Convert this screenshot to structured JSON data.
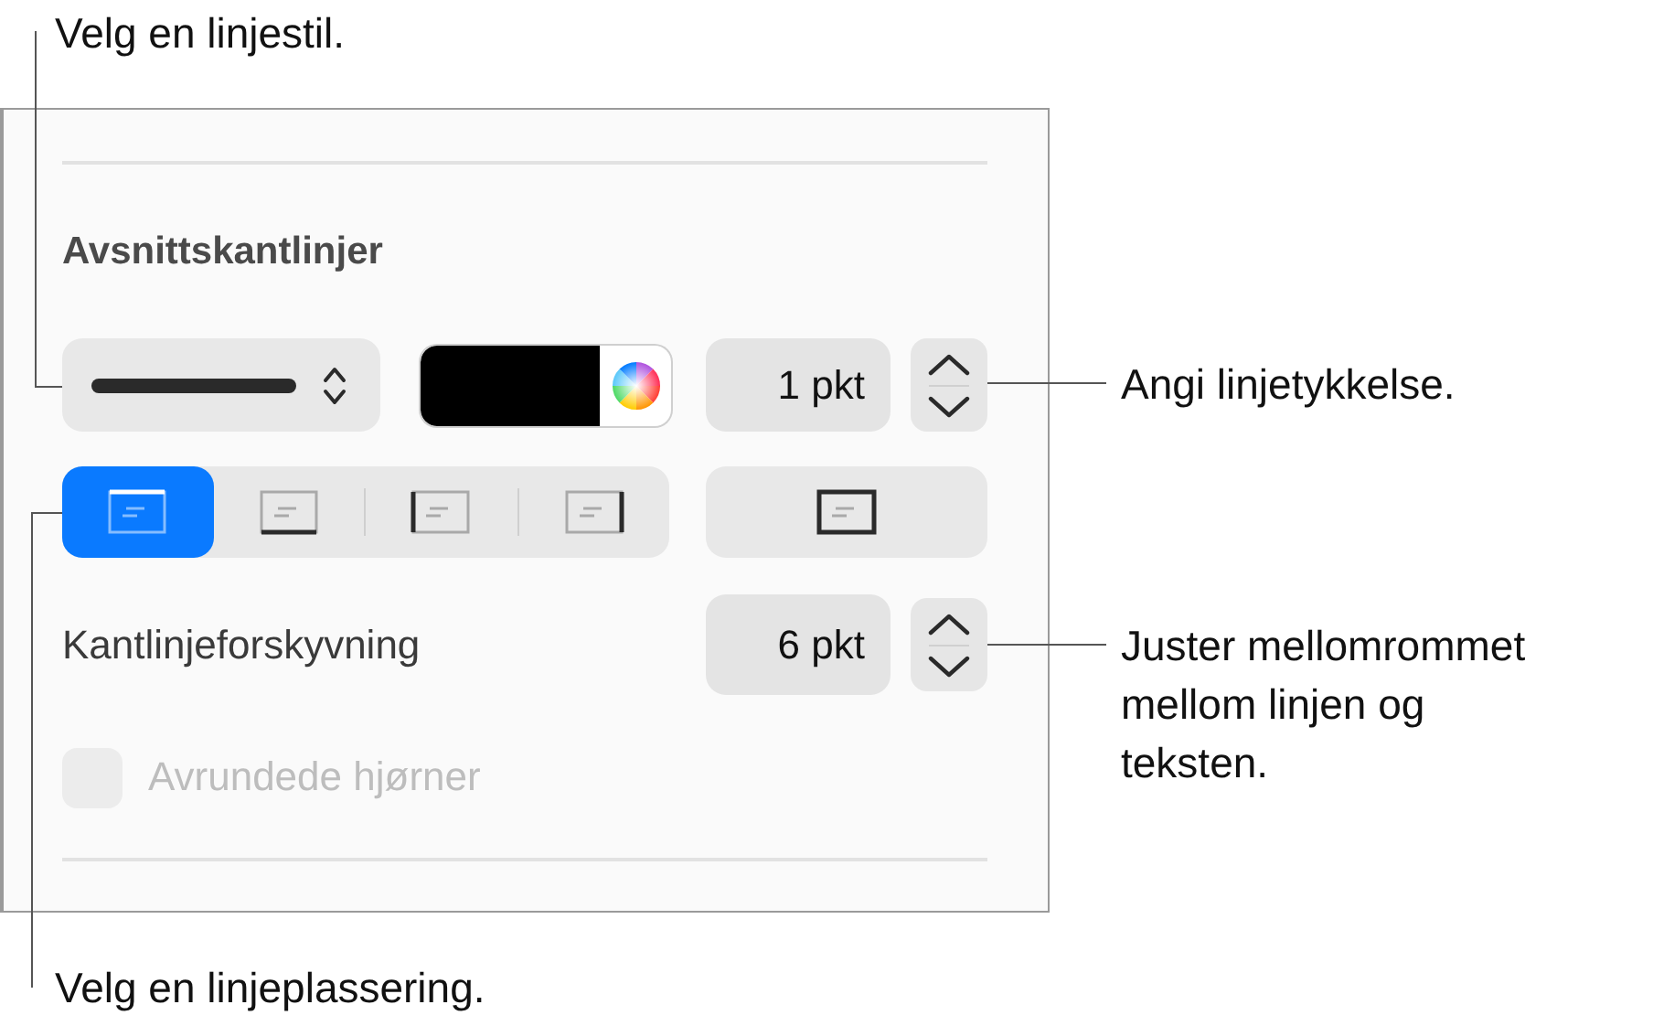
{
  "callouts": [
    {
      "kind": "top-left",
      "text": "Velg en linjestil."
    },
    {
      "kind": "right-upper",
      "text": "Angi linjetykkelse."
    },
    {
      "kind": "right-lower",
      "text": "Juster mellomrommet mellom linjen og teksten."
    },
    {
      "kind": "bottom-left",
      "text": "Velg en linjeplassering."
    }
  ],
  "panel": {
    "heading": "Avsnittskantlinjer",
    "thickness": "1 pkt",
    "positions": [
      {
        "kind": "top",
        "selected": true
      },
      {
        "kind": "bottom",
        "selected": false
      },
      {
        "kind": "left",
        "selected": false
      },
      {
        "kind": "right",
        "selected": false
      }
    ],
    "box_button": {
      "kind": "box",
      "selected": false
    },
    "offset_label": "Kantlinjeforskyvning",
    "offset": "6 pkt",
    "rounded": {
      "label": "Avrundede hjørner",
      "checked": false,
      "disabled": true
    }
  }
}
